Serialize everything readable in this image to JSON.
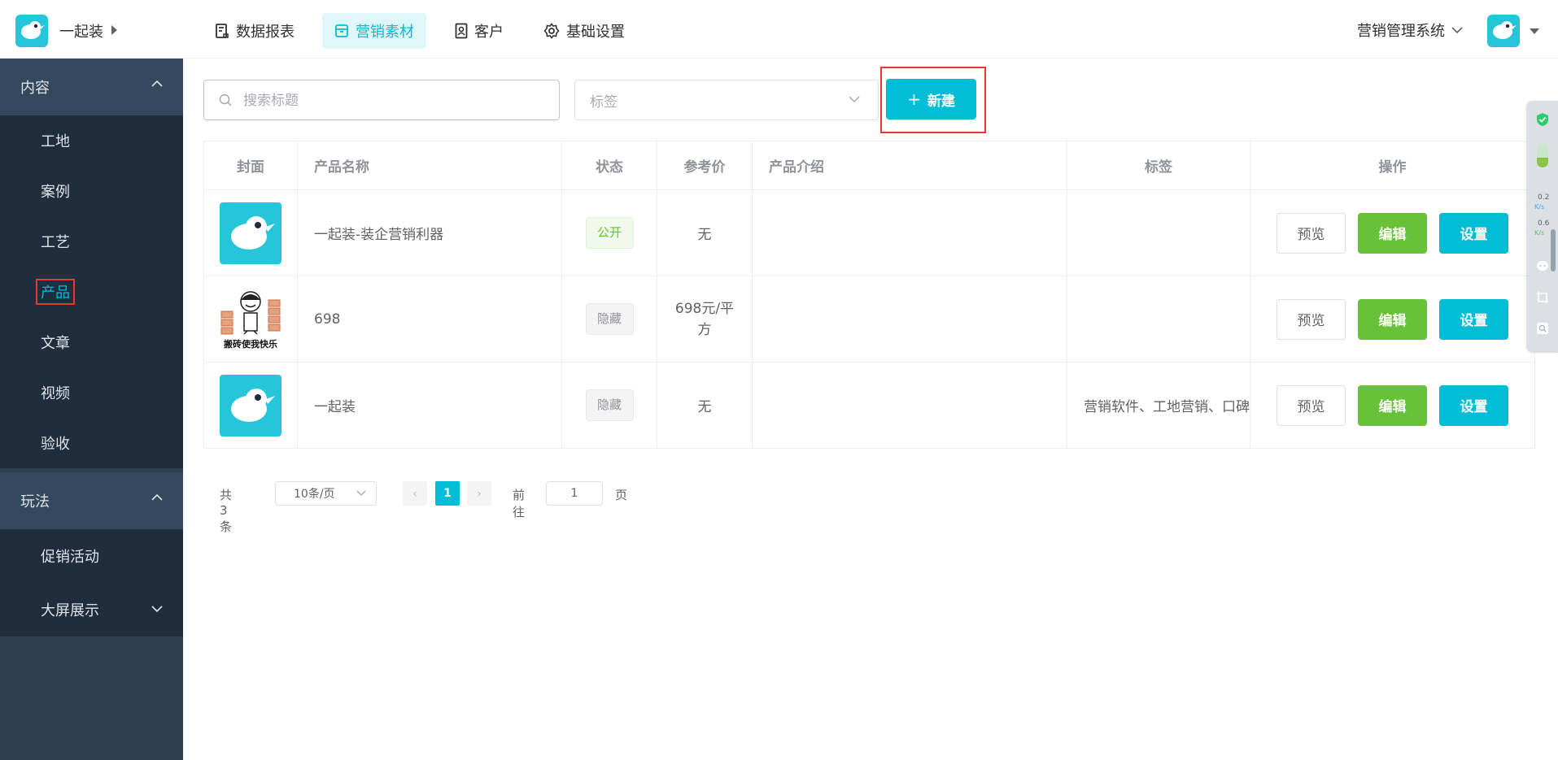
{
  "header": {
    "brand": "一起装",
    "nav": [
      {
        "label": "数据报表",
        "icon": "report-icon",
        "active": false
      },
      {
        "label": "营销素材",
        "icon": "box-icon",
        "active": true
      },
      {
        "label": "客户",
        "icon": "contact-icon",
        "active": false
      },
      {
        "label": "基础设置",
        "icon": "gear-icon",
        "active": false
      }
    ],
    "system_name": "营销管理系统"
  },
  "sidebar": {
    "groups": [
      {
        "label": "内容",
        "expanded": true,
        "items": [
          "工地",
          "案例",
          "工艺",
          "产品",
          "文章",
          "视频",
          "验收"
        ]
      },
      {
        "label": "玩法",
        "expanded": true,
        "items": [
          "促销活动",
          "大屏展示"
        ]
      }
    ],
    "active_item": "产品"
  },
  "toolbar": {
    "search_placeholder": "搜索标题",
    "tag_placeholder": "标签",
    "new_label": "新建"
  },
  "table": {
    "columns": [
      "封面",
      "产品名称",
      "状态",
      "参考价",
      "产品介绍",
      "标签",
      "操作"
    ],
    "rows": [
      {
        "cover": "logo",
        "name": "一起装-装企营销利器",
        "status": "公开",
        "status_type": "public",
        "price": "无",
        "intro": "",
        "tags": ""
      },
      {
        "cover": "meme",
        "cover_caption": "搬砖使我快乐",
        "name": "698",
        "status": "隐藏",
        "status_type": "hidden",
        "price": "698元/平方",
        "intro": "",
        "tags": ""
      },
      {
        "cover": "logo",
        "name": "一起装",
        "status": "隐藏",
        "status_type": "hidden",
        "price": "无",
        "intro": "",
        "tags": "营销软件、工地营销、口碑"
      }
    ],
    "actions": {
      "preview": "预览",
      "edit": "编辑",
      "settings": "设置"
    }
  },
  "pagination": {
    "total": "共 3 条",
    "page_size": "10条/页",
    "current_page": "1",
    "goto_label": "前往",
    "goto_value": "1",
    "page_suffix": "页"
  },
  "widget": {
    "up_speed": "0.2",
    "up_unit": "K/s",
    "down_speed": "0.6",
    "down_unit": "K/s"
  },
  "colors": {
    "accent": "#00bcd4",
    "success": "#67c23a",
    "sidebar_bg": "#2c3e50",
    "sidebar_group_bg": "#34495e",
    "sidebar_item_bg": "#1f2d3d",
    "highlight_border": "#e53935"
  }
}
